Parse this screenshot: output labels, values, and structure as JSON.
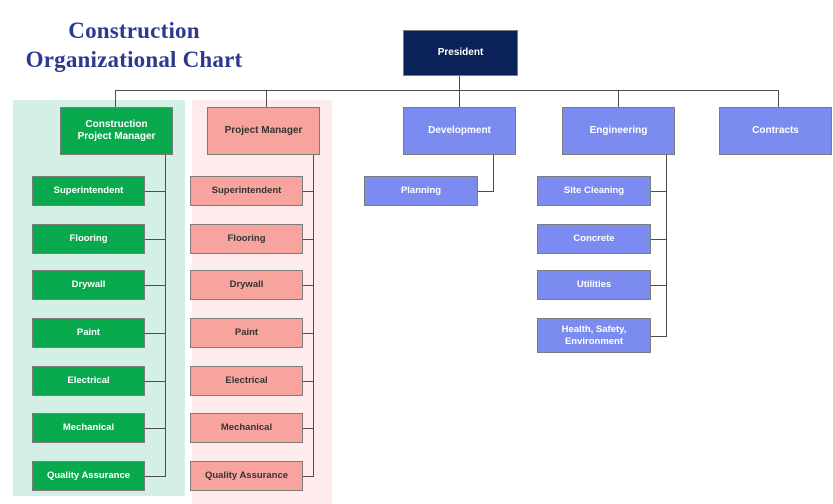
{
  "title": {
    "text": "Construction\nOrganizational Chart",
    "color": "#2b3a8f"
  },
  "colors": {
    "root_fill": "#0b2259",
    "division_fill": "#7b8bf0",
    "green_fill": "#09a94e",
    "pink_fill": "#f8a49e",
    "green_panel": "#d4efe6",
    "pink_panel": "#fdeceb",
    "connector": "#4d4d4d",
    "border": "#7c7c7c"
  },
  "chart_data": {
    "type": "diagram",
    "diagram_type": "organizational-chart",
    "root": "President",
    "nodes": [
      {
        "id": "president",
        "label": "President",
        "level": 1,
        "style": "navy"
      },
      {
        "id": "construction-project-manager",
        "label": "Construction\nProject Manager",
        "level": 2,
        "style": "green",
        "parent": "president"
      },
      {
        "id": "project-manager",
        "label": "Project Manager",
        "level": 2,
        "style": "pink",
        "parent": "president"
      },
      {
        "id": "development",
        "label": "Development",
        "level": 2,
        "style": "blue",
        "parent": "president"
      },
      {
        "id": "engineering",
        "label": "Engineering",
        "level": 2,
        "style": "blue",
        "parent": "president"
      },
      {
        "id": "contracts",
        "label": "Contracts",
        "level": 2,
        "style": "blue",
        "parent": "president"
      },
      {
        "id": "cpm-superintendent",
        "label": "Superintendent",
        "level": 3,
        "style": "green",
        "parent": "construction-project-manager"
      },
      {
        "id": "cpm-flooring",
        "label": "Flooring",
        "level": 3,
        "style": "green",
        "parent": "construction-project-manager"
      },
      {
        "id": "cpm-drywall",
        "label": "Drywall",
        "level": 3,
        "style": "green",
        "parent": "construction-project-manager"
      },
      {
        "id": "cpm-paint",
        "label": "Paint",
        "level": 3,
        "style": "green",
        "parent": "construction-project-manager"
      },
      {
        "id": "cpm-electrical",
        "label": "Electrical",
        "level": 3,
        "style": "green",
        "parent": "construction-project-manager"
      },
      {
        "id": "cpm-mechanical",
        "label": "Mechanical",
        "level": 3,
        "style": "green",
        "parent": "construction-project-manager"
      },
      {
        "id": "cpm-quality-assurance",
        "label": "Quality Assurance",
        "level": 3,
        "style": "green",
        "parent": "construction-project-manager"
      },
      {
        "id": "pm-superintendent",
        "label": "Superintendent",
        "level": 3,
        "style": "pink",
        "parent": "project-manager"
      },
      {
        "id": "pm-flooring",
        "label": "Flooring",
        "level": 3,
        "style": "pink",
        "parent": "project-manager"
      },
      {
        "id": "pm-drywall",
        "label": "Drywall",
        "level": 3,
        "style": "pink",
        "parent": "project-manager"
      },
      {
        "id": "pm-paint",
        "label": "Paint",
        "level": 3,
        "style": "pink",
        "parent": "project-manager"
      },
      {
        "id": "pm-electrical",
        "label": "Electrical",
        "level": 3,
        "style": "pink",
        "parent": "project-manager"
      },
      {
        "id": "pm-mechanical",
        "label": "Mechanical",
        "level": 3,
        "style": "pink",
        "parent": "project-manager"
      },
      {
        "id": "pm-quality-assurance",
        "label": "Quality Assurance",
        "level": 3,
        "style": "pink",
        "parent": "project-manager"
      },
      {
        "id": "planning",
        "label": "Planning",
        "level": 3,
        "style": "blue",
        "parent": "development"
      },
      {
        "id": "site-cleaning",
        "label": "Site Cleaning",
        "level": 3,
        "style": "blue",
        "parent": "engineering"
      },
      {
        "id": "concrete",
        "label": "Concrete",
        "level": 3,
        "style": "blue",
        "parent": "engineering"
      },
      {
        "id": "utilities",
        "label": "Utilities",
        "level": 3,
        "style": "blue",
        "parent": "engineering"
      },
      {
        "id": "health-safety-environment",
        "label": "Health, Safety,\nEnvironment",
        "level": 3,
        "style": "blue",
        "parent": "engineering"
      }
    ]
  },
  "nodes": {
    "president": "President",
    "construction_project_manager": "Construction\nProject Manager",
    "project_manager": "Project Manager",
    "development": "Development",
    "engineering": "Engineering",
    "contracts": "Contracts",
    "planning": "Planning",
    "green": {
      "superintendent": "Superintendent",
      "flooring": "Flooring",
      "drywall": "Drywall",
      "paint": "Paint",
      "electrical": "Electrical",
      "mechanical": "Mechanical",
      "quality_assurance": "Quality Assurance"
    },
    "pink": {
      "superintendent": "Superintendent",
      "flooring": "Flooring",
      "drywall": "Drywall",
      "paint": "Paint",
      "electrical": "Electrical",
      "mechanical": "Mechanical",
      "quality_assurance": "Quality Assurance"
    },
    "engineering_children": {
      "site_cleaning": "Site Cleaning",
      "concrete": "Concrete",
      "utilities": "Utilities",
      "health_safety_environment": "Health, Safety,\nEnvironment"
    }
  }
}
